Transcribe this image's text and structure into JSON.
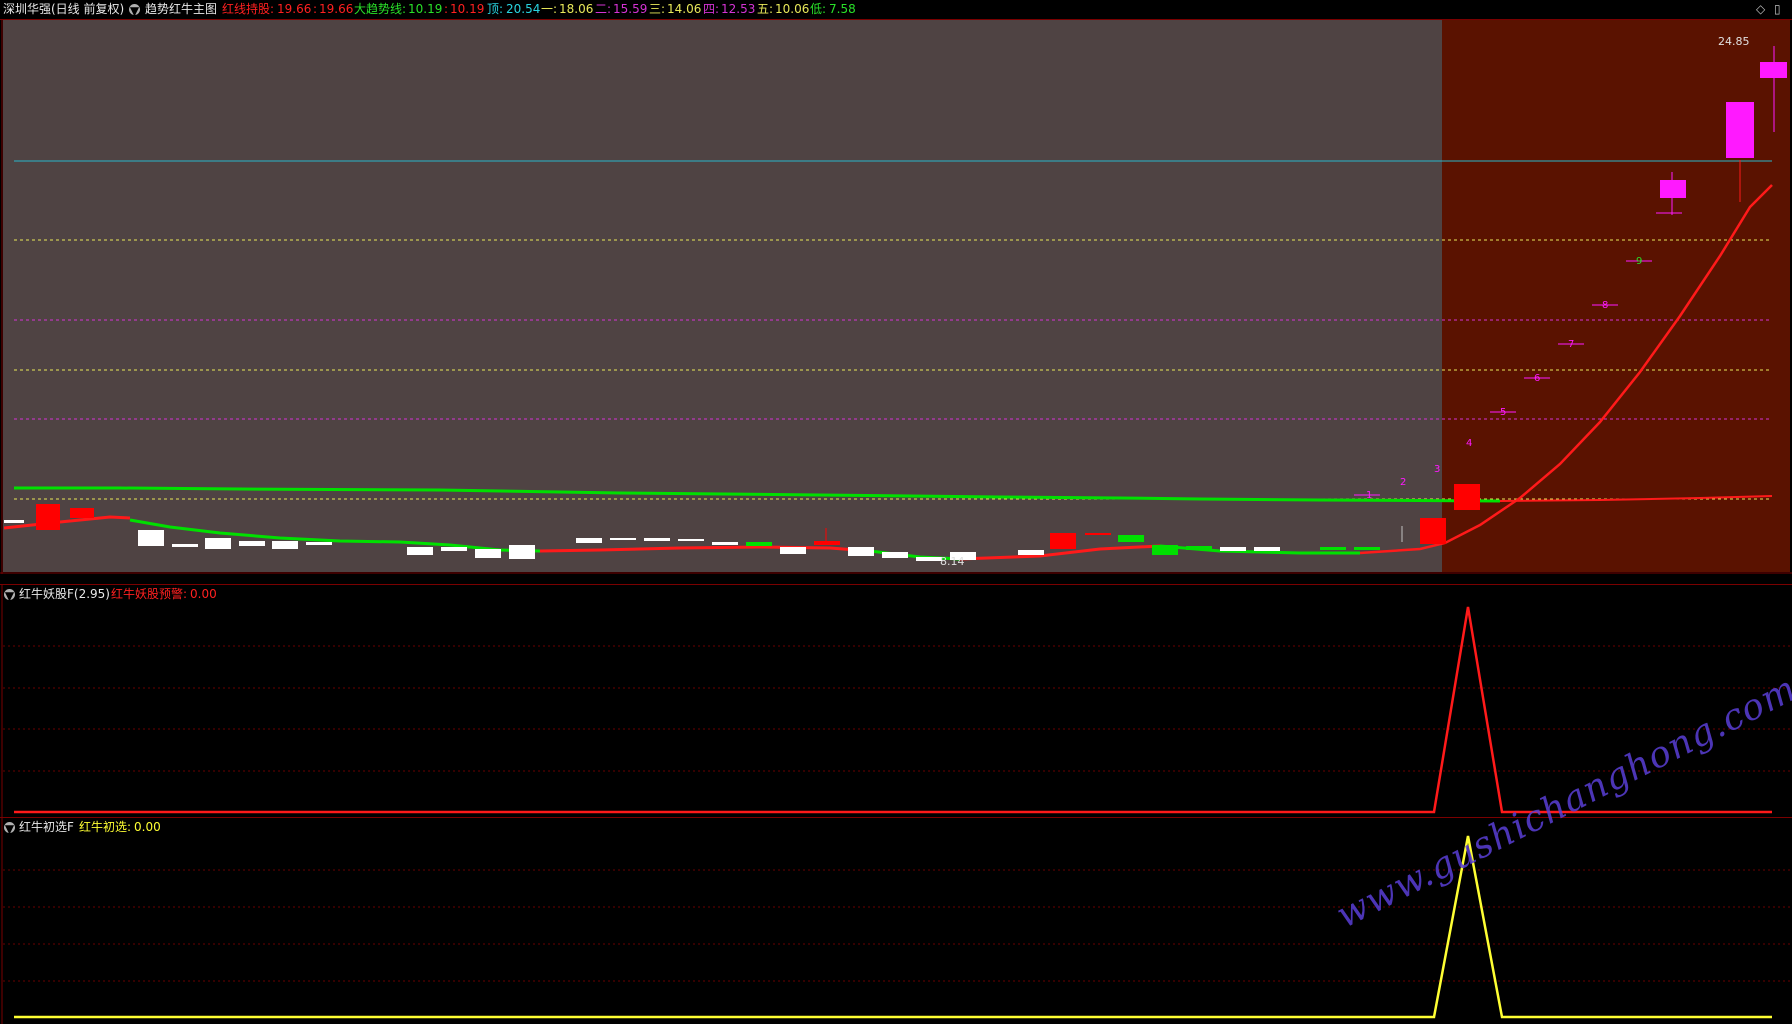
{
  "header": {
    "stock_name": "深圳华强(日线 前复权)",
    "indicator_name": "趋势红牛主图",
    "red_line_label": "红线持股",
    "red_line_value_1": "19.66",
    "red_line_value_2": "19.66",
    "trend_label": "大趋势线",
    "trend_value_1": "10.19",
    "trend_value_2": "10.19",
    "top_label": "顶",
    "top_value": "20.54",
    "l1_label": "一",
    "l1_value": "18.06",
    "l2_label": "二",
    "l2_value": "15.59",
    "l3_label": "三",
    "l3_value": "14.06",
    "l4_label": "四",
    "l4_value": "12.53",
    "l5_label": "五",
    "l5_value": "10.06",
    "low_label": "低",
    "low_value": "7.58",
    "max_price_label": "24.85",
    "min_price_label": "8.14"
  },
  "panel2": {
    "name": "红牛妖股F(2.95)",
    "series_label": "红牛妖股预警",
    "series_value": "0.00"
  },
  "panel3": {
    "name": "红牛初选F",
    "series_label": "红牛初选",
    "series_value": "0.00"
  },
  "rise_day_labels": [
    "1",
    "2",
    "3",
    "4",
    "5",
    "6",
    "7",
    "8",
    "9"
  ],
  "watermark": "www.gushichanghong.com",
  "colors": {
    "background": "#000000",
    "main_bg_left": "#4f4343",
    "main_bg_right": "#5a1200",
    "up_candle": "#ff0000",
    "down_candle": "#ffffff",
    "trend_green": "#00e000",
    "red_line": "#ff1a1a",
    "cyan_line": "#29b6c8",
    "yellow_dash": "#e8e85a",
    "magenta_dash": "#d433d4",
    "magenta_candle": "#ff19ff",
    "panel2_line": "#ff1a1a",
    "panel3_line": "#ffff33"
  }
}
